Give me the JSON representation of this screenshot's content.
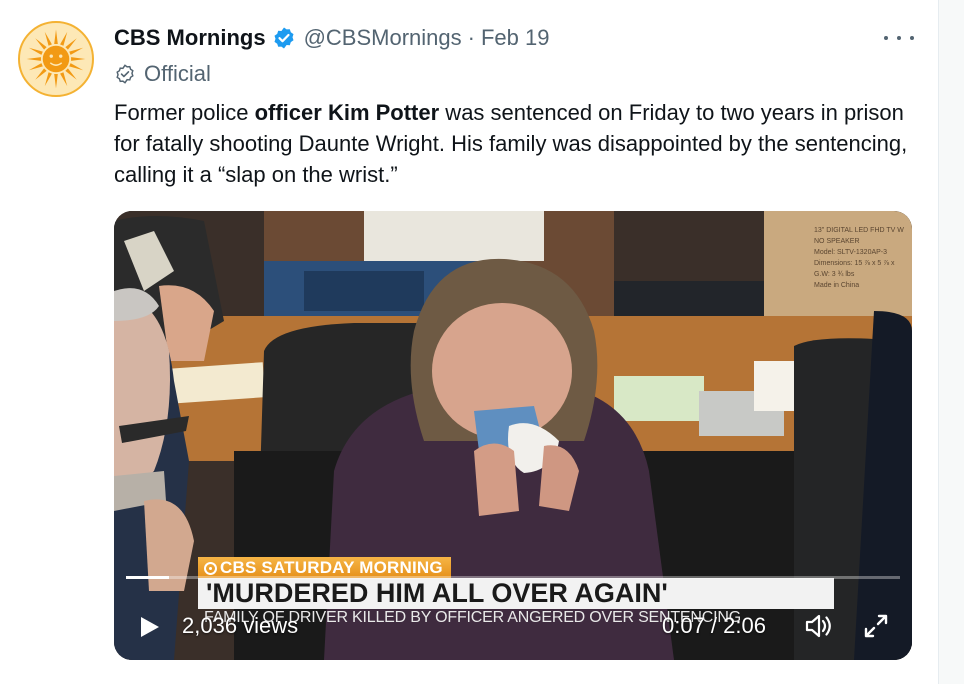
{
  "tweet": {
    "display_name": "CBS Mornings",
    "handle": "@CBSMornings",
    "separator": "·",
    "date": "Feb 19",
    "label": "Official",
    "text_before": "Former police ",
    "text_bold": "officer Kim Potter",
    "text_after": " was sentenced on Friday to two years in prison for fatally shooting Daunte Wright. His family was disappointed by the sentencing, calling it a “slap on the wrist.”"
  },
  "video": {
    "box_label_lines": [
      "13\" DIGITAL LED FHD TV W",
      "NO SPEAKER",
      "Model: SLTV-1320AP-3",
      "Dimensions: 15 ⅞ x 5 ⅞ x",
      "G.W: 3 ¾ lbs",
      "Made in China"
    ],
    "network_tag": "CBS SATURDAY MORNING",
    "headline": "'MURDERED HIM ALL OVER AGAIN'",
    "subline": "FAMILY OF DRIVER KILLED BY OFFICER ANGERED OVER SENTENCING",
    "views": "2,036 views",
    "time_display": "0:07 / 2:06",
    "progress_fraction": 0.056
  },
  "icons": {
    "avatar": "cbs-sun-logo",
    "verified": "verified-badge-icon",
    "official": "official-badge-icon",
    "more": "more-options-icon",
    "play": "play-icon",
    "volume": "volume-icon",
    "fullscreen": "fullscreen-icon"
  },
  "colors": {
    "verified_blue": "#1d9bf0",
    "cbs_orange": "#e58f18",
    "secondary_text": "#536471"
  }
}
